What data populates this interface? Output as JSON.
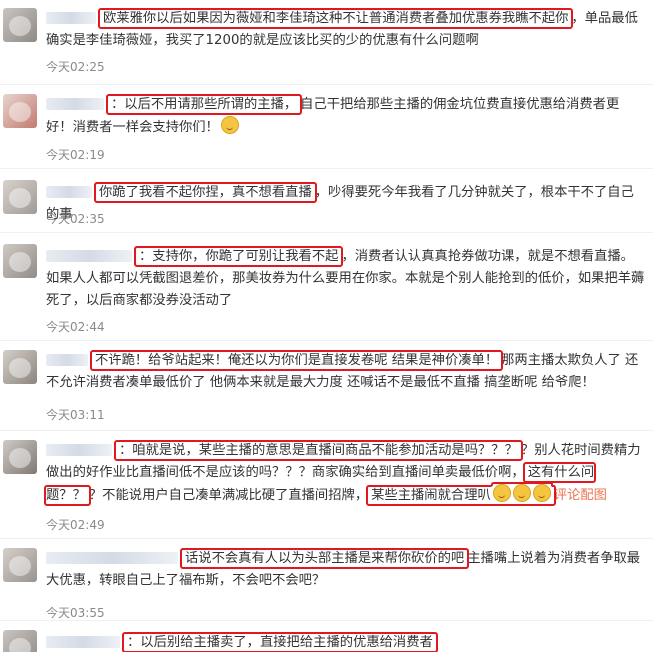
{
  "comments": [
    {
      "pre": "",
      "highlight": "欧莱雅你以后如果因为薇娅和李佳琦这种不让普通消费者叠加优惠券我瞧不起你",
      "post": "，单品最低确实是李佳琦薇娅，我买了1200的就是应该比买的少的优惠有什么问题啊",
      "time": "今天02:25"
    },
    {
      "pre": "",
      "highlight": "：以后不用请那些所谓的主播，",
      "post": "自己干把给那些主播的佣金坑位费直接优惠给消费者更好！消费者一样会支持你们！",
      "time": "今天02:19"
    },
    {
      "pre": "",
      "highlight": "你跪了我看不起你捏，真不想看直播",
      "post": "，吵得要死今年我看了几分钟就关了，根本干不了自己的事",
      "time": "今天02:35"
    },
    {
      "pre": "",
      "highlight": "：支持你，你跪了可别让我看不起",
      "post": "，消费者认认真真抢券做功课，就是不想看直播。如果人人都可以凭截图退差价，那美妆券为什么要用在你家。本就是个别人能抢到的低价，如果把羊薅死了，以后商家都没券没活动了",
      "time": "今天02:44"
    },
    {
      "pre": "",
      "highlight": "不许跪！给爷站起来！俺还以为你们是直接发卷呢 结果是神价凑单！",
      "post": "那两主播太欺负人了 还不允许消费者凑单最低价了 他俩本来就是最大力度 还喊话不是最低不直播 搞垄断呢 给爷爬！",
      "time": "今天03:11"
    },
    {
      "pre": "",
      "highlight": "：咱就是说，某些主播的意思是直播间商品不能参加活动是吗？？？",
      "post": "？别人花时间费精力做出的好作业比直播间低不是应该的吗？？？商家确实给到直播间单卖最低价啊，",
      "highlight2": "这有什么问题？？",
      "post2": "？不能说用户自己凑单满减比硬了直播间招牌，",
      "highlight3": "某些主播闹就合理叭",
      "link": "评论配图",
      "time": "今天02:49"
    },
    {
      "pre": "",
      "highlight": "话说不会真有人以为头部主播是来帮你砍价的吧",
      "post": "主播嘴上说着为消费者争取最大优惠，转眼自己上了福布斯，不会吧不会吧？",
      "time": "今天03:55"
    },
    {
      "pre": "",
      "highlight": "：以后别给主播卖了，直接把给主播的优惠给消费者",
      "post": "",
      "time": ""
    }
  ]
}
